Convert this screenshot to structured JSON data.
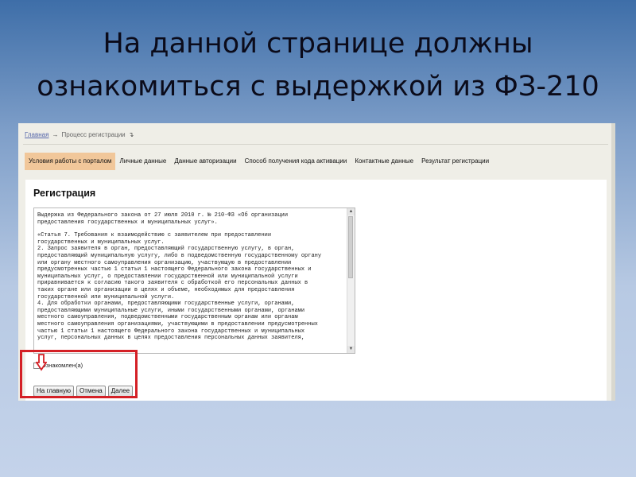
{
  "slide": {
    "title_line1": "На данной странице должны",
    "title_line2": "ознакомиться с выдержкой из ФЗ-210",
    "highlight_color": "#d42026"
  },
  "breadcrumb": {
    "home": "Главная",
    "current": "Процесс регистрации"
  },
  "tabs": [
    {
      "label": "Условия работы с порталом",
      "active": true
    },
    {
      "label": "Личные данные",
      "active": false
    },
    {
      "label": "Данные авторизации",
      "active": false
    },
    {
      "label": "Способ получения кода активации",
      "active": false
    },
    {
      "label": "Контактные данные",
      "active": false
    },
    {
      "label": "Результат регистрации",
      "active": false
    }
  ],
  "form": {
    "title": "Регистрация",
    "law_text": {
      "para1": "Выдержка из Федерального закона от 27 июля 2010 г. № 210-ФЗ «Об организации\nпредоставления государственных и муниципальных услуг».",
      "para2": "«Статья 7. Требования к взаимодействию с заявителем при предоставлении\nгосударственных и муниципальных услуг.\n2. Запрос заявителя в орган, предоставляющий государственную услугу, в орган,\nпредоставляющий муниципальную услугу, либо в подведомственную государственному органу\nили органу местного самоуправления организацию, участвующую в предоставлении\nпредусмотренных частью 1 статьи 1 настоящего Федерального закона государственных и\nмуниципальных услуг, о предоставлении государственной или муниципальной услуги\nприравнивается к согласию такого заявителя с обработкой его персональных данных в\nтаких органе или организации в целях и объеме, необходимых для предоставления\nгосударственной или муниципальной услуги.\n4. Для обработки органами, предоставляющими государственные услуги, органами,\nпредоставляющими муниципальные услуги, иными государственными органами, органами\nместного самоуправления, подведомственными государственным органам или органам\nместного самоуправления организациями, участвующими в предоставлении предусмотренных\nчастью 1 статьи 1 настоящего Федерального закона государственных и муниципальных\nуслуг, персональных данных в целях предоставления персональных данных заявителя,"
    },
    "checkbox_label": "Ознакомлен(а)",
    "checkbox_checked": false,
    "buttons": {
      "home": "На главную",
      "cancel": "Отмена",
      "next": "Далее"
    }
  }
}
